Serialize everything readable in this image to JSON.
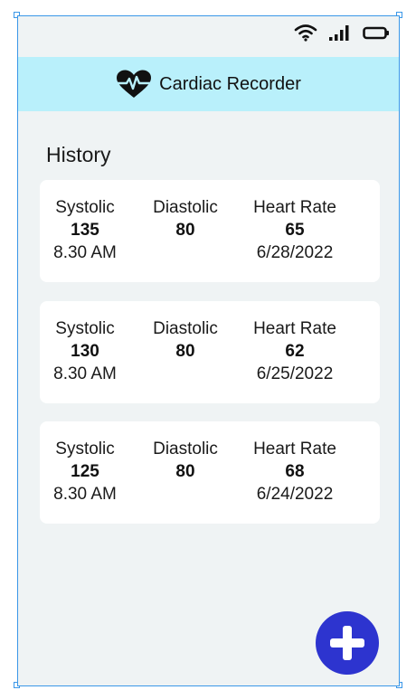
{
  "app": {
    "title": "Cardiac Recorder"
  },
  "history": {
    "title": "History",
    "records": [
      {
        "systolic_label": "Systolic",
        "systolic": "135",
        "time": "8.30 AM",
        "diastolic_label": "Diastolic",
        "diastolic": "80",
        "heart_rate_label": "Heart Rate",
        "heart_rate": "65",
        "date": "6/28/2022"
      },
      {
        "systolic_label": "Systolic",
        "systolic": "130",
        "time": "8.30 AM",
        "diastolic_label": "Diastolic",
        "diastolic": "80",
        "heart_rate_label": "Heart Rate",
        "heart_rate": "62",
        "date": "6/25/2022"
      },
      {
        "systolic_label": "Systolic",
        "systolic": "125",
        "time": "8.30 AM",
        "diastolic_label": "Diastolic",
        "diastolic": "80",
        "heart_rate_label": "Heart Rate",
        "heart_rate": "68",
        "date": "6/24/2022"
      }
    ]
  },
  "icons": {
    "logo": "heart-pulse-icon",
    "wifi": "wifi-icon",
    "signal": "signal-bars-icon",
    "battery": "battery-icon",
    "add": "plus-icon"
  },
  "colors": {
    "header_bg": "#b9f0fb",
    "screen_bg": "#eff3f4",
    "fab": "#2d34cf",
    "selection": "#3a97e8"
  }
}
